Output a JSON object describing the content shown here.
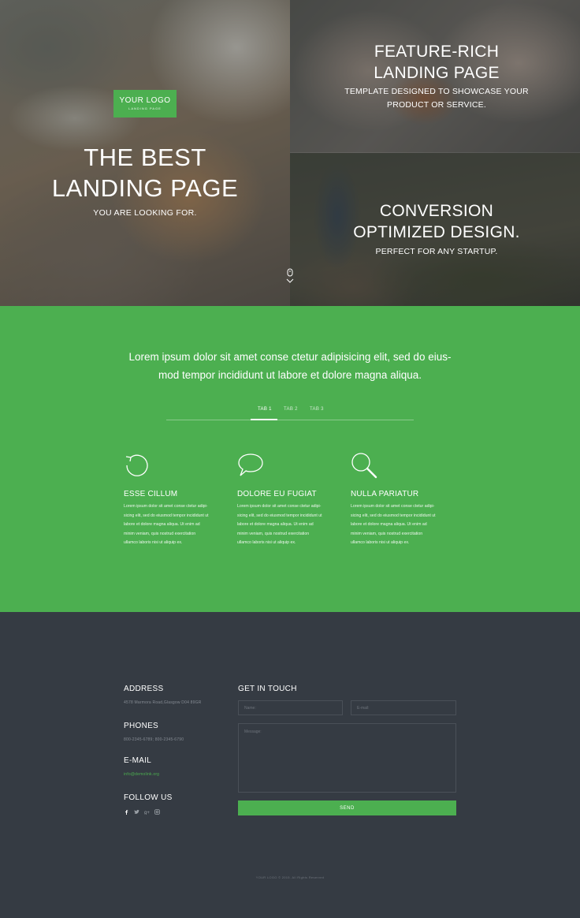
{
  "hero": {
    "logo": {
      "main": "YOUR LOGO",
      "sub": "LANDING PAGE"
    },
    "title_line1": "THE BEST",
    "title_line2": "LANDING PAGE",
    "subtitle": "YOU ARE LOOKING FOR.",
    "feature_rich": {
      "title_line1": "FEATURE-RICH",
      "title_line2": "LANDING PAGE",
      "sub_line1": "TEMPLATE DESIGNED TO SHOWCASE YOUR",
      "sub_line2": "PRODUCT OR SERVICE."
    },
    "conversion": {
      "title_line1": "CONVERSION",
      "title_line2": "OPTIMIZED DESIGN.",
      "sub": "PERFECT FOR ANY STARTUP."
    },
    "scroll_icon": "mouse-scroll-icon"
  },
  "intro": {
    "line1": "Lorem ipsum dolor sit amet conse ctetur adipisicing elit, sed do eius-",
    "line2": "mod tempor incididunt ut labore et dolore magna aliqua."
  },
  "tabs": [
    {
      "label": "TAB 1",
      "active": true
    },
    {
      "label": "TAB 2",
      "active": false
    },
    {
      "label": "TAB 3",
      "active": false
    }
  ],
  "features": [
    {
      "icon": "refresh-icon",
      "title": "ESSE CILLUM",
      "lines": [
        "Lorem ipsum dolor sit amet conse ctetur adipi-",
        "sicing elit, sed do eiusmod tempor incididunt ut",
        "labore et dolore magna aliqua. Ut enim ad",
        "minim veniam, quis nostrud exercitation",
        "ullamco laboris nisi ut aliquip ex."
      ]
    },
    {
      "icon": "chat-bubble-icon",
      "title": "DOLORE EU FUGIAT",
      "lines": [
        "Lorem ipsum dolor sit amet conse ctetur adipi-",
        "sicing elit, sed do eiusmod tempor incididunt ut",
        "labore et dolore magna aliqua. Ut enim ad",
        "minim veniam, quis nostrud exercitation",
        "ullamco laboris nisi ut aliquip ex."
      ]
    },
    {
      "icon": "search-icon",
      "title": "NULLA PARIATUR",
      "lines": [
        "Lorem ipsum dolor sit amet conse ctetur adipi-",
        "sicing elit, sed do eiusmod tempor incididunt ut",
        "labore et dolore magna aliqua. Ut enim ad",
        "minim veniam, quis nostrud exercitation",
        "ullamco laboris nisi ut aliquip ex."
      ]
    }
  ],
  "contact": {
    "address_label": "ADDRESS",
    "address_value": "4578 Marmora Road,Glasgow D04 89GR",
    "phones_label": "PHONES",
    "phones_value": "800-2345-6789;  800-2345-6790",
    "email_label": "E-MAIL",
    "email_value": "info@demolink.org",
    "follow_label": "FOLLOW US",
    "social_icons": [
      "facebook-icon",
      "twitter-icon",
      "google-plus-icon",
      "instagram-icon"
    ],
    "form": {
      "title": "GET IN TOUCH",
      "name_placeholder": "Name:",
      "email_placeholder": "E-mail:",
      "message_placeholder": "Message:",
      "send_label": "SEND"
    }
  },
  "footer": {
    "copyright": "YOUR LOGO  © 2015. All Rights Reserved"
  },
  "colors": {
    "accent_green": "#4caf50",
    "dark_bg": "#353b43"
  }
}
